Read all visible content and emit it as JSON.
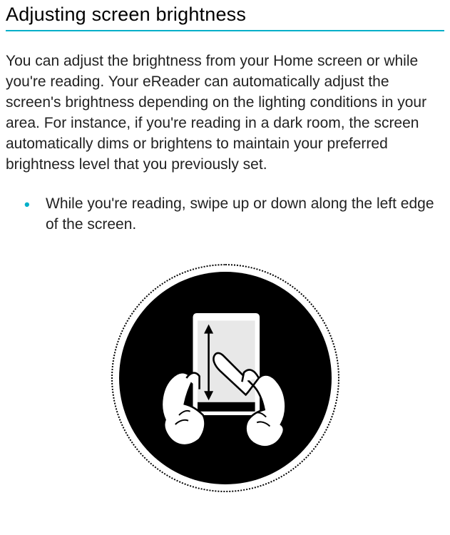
{
  "heading": "Adjusting screen brightness",
  "body": "You can adjust the brightness from your Home screen or while you're reading. Your eReader can automatically adjust the screen's brightness depending on the lighting conditions in your area. For instance, if you're reading in a dark room, the screen automatically dims or brightens to maintain your preferred brightness level that you previously set.",
  "bullets": [
    "While you're reading, swipe up or down along the left edge of the screen."
  ],
  "illustration": {
    "name": "swipe-brightness-gesture-icon",
    "description": "Two hands holding an eReader device with a finger swiping vertically, shown inside a black circle with a dotted ring border"
  },
  "colors": {
    "accent": "#00afc9"
  }
}
